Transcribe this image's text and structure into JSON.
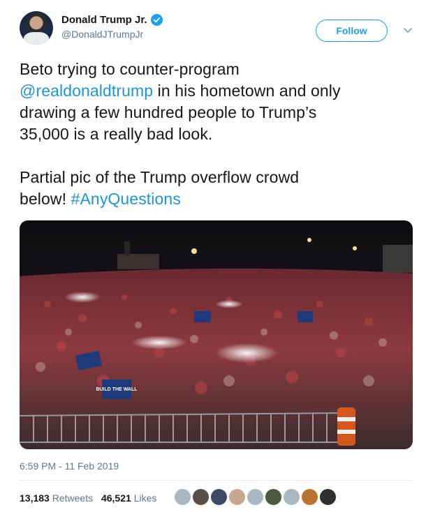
{
  "user": {
    "display_name": "Donald Trump Jr.",
    "handle": "@DonaldJTrumpJr",
    "verified": true
  },
  "follow_label": "Follow",
  "tweet": {
    "lines_p1": [
      "Beto trying to counter-program",
      "in his hometown and only",
      "drawing a few hundred people to Trump’s",
      "35,000 is a really bad look."
    ],
    "mention": "@realdonaldtrump",
    "lines_p2": [
      "Partial pic of the Trump overflow crowd",
      "below!"
    ],
    "hashtag": "#AnyQuestions"
  },
  "media": {
    "sign_texts": [
      "BUILD THE WALL"
    ]
  },
  "timestamp": "6:59 PM - 11 Feb 2019",
  "stats": {
    "retweets_count": "13,183",
    "retweets_label": "Retweets",
    "likes_count": "46,521",
    "likes_label": "Likes"
  },
  "likers": [
    {
      "name": "liker-1",
      "color": "#aab8c2"
    },
    {
      "name": "liker-2",
      "color": "#5b4f45"
    },
    {
      "name": "liker-3",
      "color": "#3e4a66"
    },
    {
      "name": "liker-4",
      "color": "#c7a88e"
    },
    {
      "name": "liker-5",
      "color": "#aab8c2"
    },
    {
      "name": "liker-6",
      "color": "#4d5a3d"
    },
    {
      "name": "liker-7",
      "color": "#aab8c2"
    },
    {
      "name": "liker-8",
      "color": "#b8732f"
    },
    {
      "name": "liker-9",
      "color": "#2f2f2f"
    }
  ],
  "colors": {
    "accent": "#1da1f2",
    "link": "#1b95e0",
    "muted": "#657786"
  }
}
